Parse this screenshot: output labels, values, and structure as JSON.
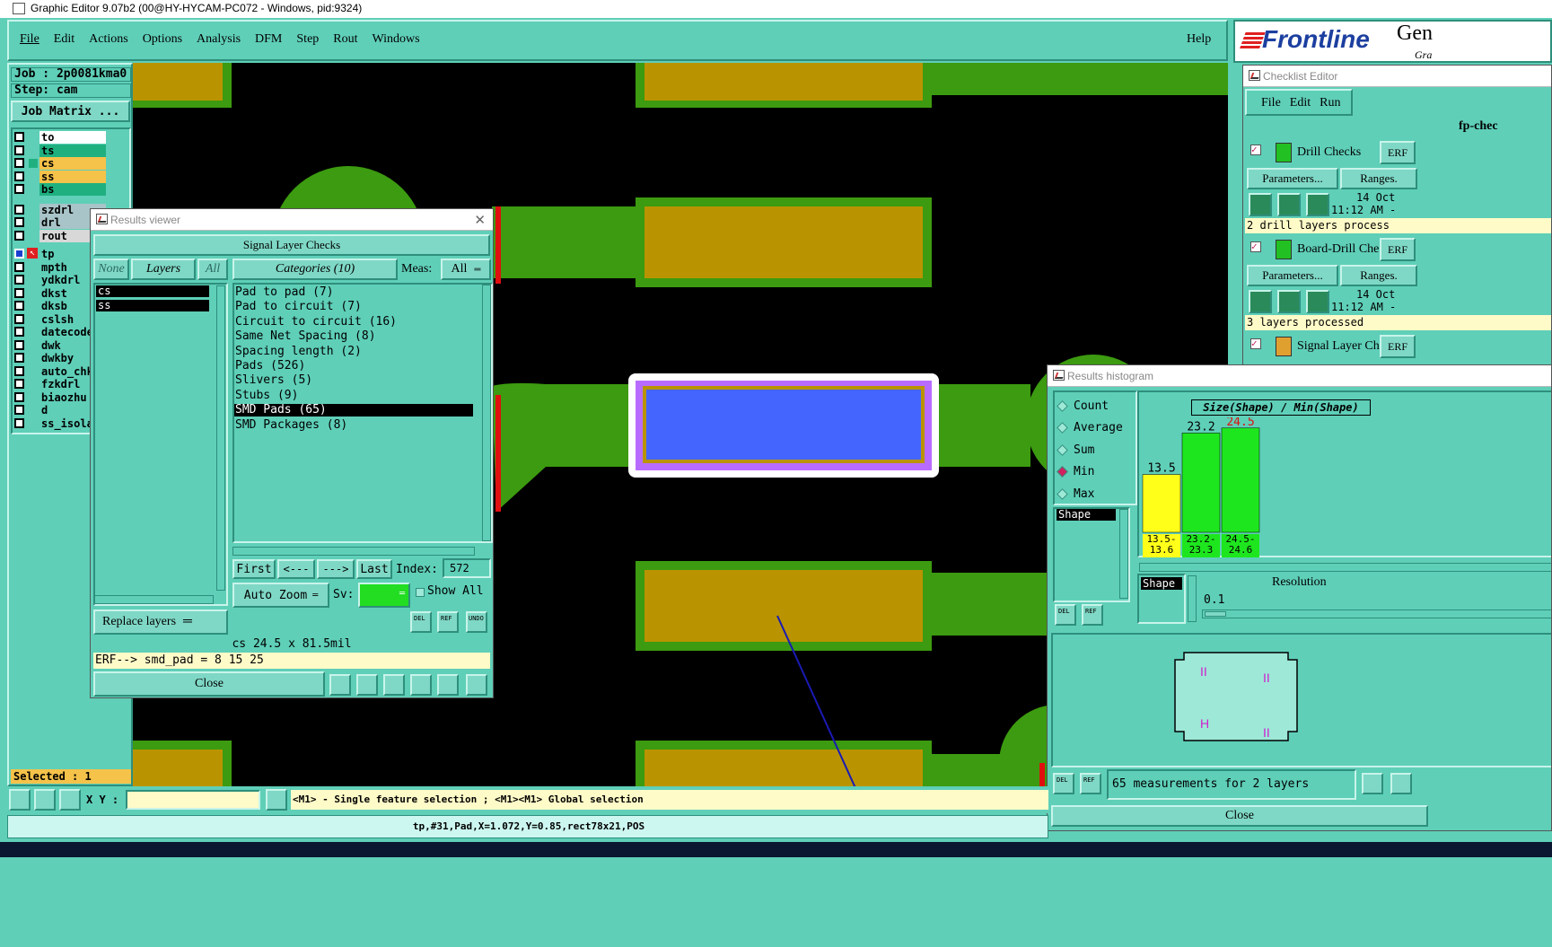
{
  "window": {
    "title": "Graphic Editor 9.07b2 (00@HY-HYCAM-PC072 - Windows, pid:9324)"
  },
  "menu": {
    "items": [
      "File",
      "Edit",
      "Actions",
      "Options",
      "Analysis",
      "DFM",
      "Step",
      "Rout",
      "Windows"
    ],
    "help": "Help"
  },
  "brand": {
    "logo": "Frontline",
    "product": "Gen",
    "sub": "Gra"
  },
  "left": {
    "job": "Job : 2p0081kma0",
    "step": "Step: cam",
    "job_matrix": "Job Matrix ...",
    "layers": [
      {
        "name": "to",
        "color": "#ffffff"
      },
      {
        "name": "ts",
        "color": "#20b080"
      },
      {
        "name": "cs",
        "color": "#f5c24a"
      },
      {
        "name": "ss",
        "color": "#f5c24a"
      },
      {
        "name": "bs",
        "color": "#20b080"
      },
      {
        "name": "szdrl",
        "color": "#a8c4c8"
      },
      {
        "name": "drl",
        "color": "#a8c4c8"
      },
      {
        "name": "rout",
        "color": "#d8d8d8"
      },
      {
        "name": "tp",
        "color": "#5fcfb8"
      },
      {
        "name": "mpth",
        "color": "#5fcfb8"
      },
      {
        "name": "ydkdrl",
        "color": "#5fcfb8"
      },
      {
        "name": "dkst",
        "color": "#5fcfb8"
      },
      {
        "name": "dksb",
        "color": "#5fcfb8"
      },
      {
        "name": "cslsh",
        "color": "#5fcfb8"
      },
      {
        "name": "datecode-",
        "color": "#5fcfb8"
      },
      {
        "name": "dwk",
        "color": "#5fcfb8"
      },
      {
        "name": "dwkby",
        "color": "#5fcfb8"
      },
      {
        "name": "auto_chk_",
        "color": "#5fcfb8"
      },
      {
        "name": "fzkdrl",
        "color": "#5fcfb8"
      },
      {
        "name": "biaozhu",
        "color": "#5fcfb8"
      },
      {
        "name": "d",
        "color": "#5fcfb8"
      },
      {
        "name": "ss_isolat",
        "color": "#5fcfb8"
      }
    ],
    "selected": "Selected : 1"
  },
  "results_viewer": {
    "title": "Results viewer",
    "header": "Signal Layer Checks",
    "none_btn": "None",
    "layers_btn": "Layers",
    "all_btn": "All",
    "layer_list": [
      "cs",
      "ss"
    ],
    "categories_btn": "Categories (10)",
    "meas_label": "Meas:",
    "meas_value": "All",
    "categories": [
      "Pad to pad (7)",
      "Pad to circuit (7)",
      "Circuit to circuit (16)",
      "Same Net Spacing (8)",
      "Spacing length (2)",
      "Pads (526)",
      "Slivers (5)",
      "Stubs (9)",
      "SMD Pads (65)",
      "SMD Packages (8)"
    ],
    "selected_category": "SMD Pads (65)",
    "first": "First",
    "prev": "<---",
    "next": "--->",
    "last": "Last",
    "index_label": "Index:",
    "index_value": "572",
    "auto_zoom": "Auto Zoom",
    "sv_label": "Sv:",
    "show_all": "Show All",
    "replace_layers": "Replace layers",
    "del": "DEL",
    "ref": "REF",
    "undo": "UNDO",
    "measure": "cs 24.5 x 81.5mil",
    "erf": "ERF--> smd_pad = 8 15 25",
    "close": "Close"
  },
  "checklist": {
    "title": "Checklist Editor",
    "menu": [
      "File",
      "Edit",
      "Run"
    ],
    "name": "fp-chec",
    "checks": [
      {
        "name": "Drill Checks",
        "erf": "ERF",
        "params": "Parameters...",
        "ranges": "Ranges.",
        "date": "14 Oct",
        "time": "11:12 AM -",
        "status": "2 drill layers process"
      },
      {
        "name": "Board-Drill Che",
        "erf": "ERF",
        "params": "Parameters...",
        "ranges": "Ranges.",
        "date": "14 Oct",
        "time": "11:12 AM -",
        "status": "3 layers processed"
      },
      {
        "name": "Signal Layer Ch",
        "erf": "ERF"
      }
    ]
  },
  "histogram": {
    "title": "Results histogram",
    "modes": [
      "Count",
      "Average",
      "Sum",
      "Min",
      "Max"
    ],
    "selected_mode": "Min",
    "list": [
      "Shape"
    ],
    "chart_title": "Size(Shape) / Min(Shape)",
    "bars": [
      {
        "value": "13.5",
        "range": "13.5-\n13.6",
        "height": 0.46,
        "color": "#ffff1a",
        "label_color": "#000000"
      },
      {
        "value": "23.2",
        "range": "23.2-\n23.3",
        "height": 0.79,
        "color": "#1ee61e",
        "label_color": "#000000"
      },
      {
        "value": "24.5",
        "range": "24.5-\n24.6",
        "height": 0.83,
        "color": "#1ee61e",
        "label_color": "#e01010"
      }
    ],
    "shape_label": "Shape",
    "resolution_label": "Resolution",
    "resolution_value": "0.1",
    "summary": "65 measurements for 2 layers",
    "close": "Close",
    "del": "DEL",
    "ref": "REF"
  },
  "bottom": {
    "xy_label": "X Y :",
    "hint": "<M1> - Single feature selection ; <M1><M1> Global selection",
    "status": "tp,#31,Pad,X=1.072,Y=0.85,rect78x21,POS"
  },
  "colors": {
    "panel": "#5fcfb8",
    "pcb_bg": "#000000",
    "copper": "#3c9b10",
    "pad": "#b99400",
    "highlight_pad": "#4466ff",
    "highlight_border": "#b86cff"
  }
}
